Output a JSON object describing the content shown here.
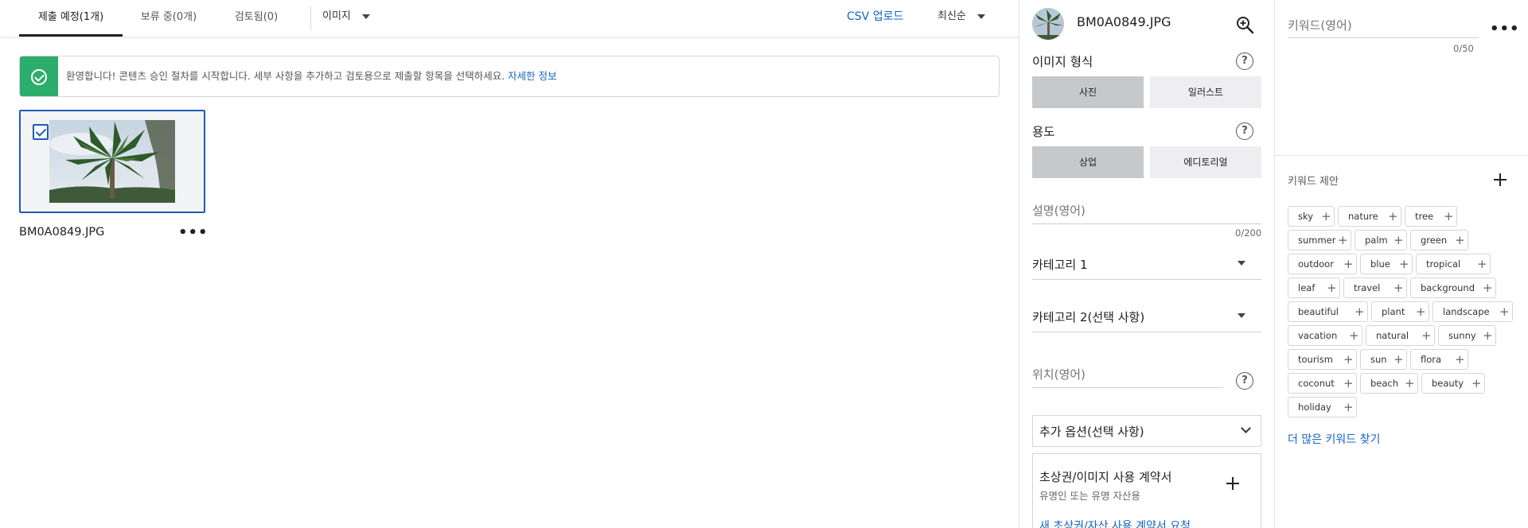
{
  "topbar": {
    "tabs": [
      {
        "label": "제출 예정(1개)",
        "active": true
      },
      {
        "label": "보류 중(0개)",
        "active": false
      },
      {
        "label": "검토됨(0)",
        "active": false
      }
    ],
    "filter_type": "이미지",
    "csv_upload": "CSV 업로드",
    "sort": "최신순"
  },
  "alert": {
    "message": "환영합니다! 콘텐츠 승인 절차를 시작합니다. 세부 사항을 추가하고 검토용으로 제출할 항목을 선택하세요.",
    "link": "자세한 정보",
    "icon": "check-circle-icon",
    "color": "#2bad6b"
  },
  "card": {
    "filename": "BM0A0849.JPG",
    "selected": true
  },
  "details": {
    "filename": "BM0A0849.JPG",
    "image_type_label": "이미지 형식",
    "image_type_options": [
      "사진",
      "일러스트"
    ],
    "usage_label": "용도",
    "usage_options": [
      "상업",
      "에디토리얼"
    ],
    "description_placeholder": "설명(영어)",
    "description_counter": "0/200",
    "category1": "카테고리 1",
    "category2": "카테고리 2(선택 사항)",
    "location_placeholder": "위치(영어)",
    "extra_options": "추가 옵션(선택 사항)",
    "release_title": "초상권/이미지 사용 계약서",
    "release_subtitle": "유명인 또는 유명 자산용",
    "release_link": "새 초상권/자산 사용 계약서 요청"
  },
  "keywords": {
    "placeholder": "키워드(영어)",
    "counter": "0/50",
    "suggest_title": "키워드 제안",
    "suggestions": [
      "sky",
      "nature",
      "tree",
      "summer",
      "palm",
      "green",
      "outdoor",
      "blue",
      "tropical",
      "leaf",
      "travel",
      "background",
      "beautiful",
      "plant",
      "landscape",
      "vacation",
      "natural",
      "sunny",
      "tourism",
      "sun",
      "flora",
      "coconut",
      "beach",
      "beauty",
      "holiday"
    ],
    "find_more": "더 많은 키워드 찾기"
  },
  "colors": {
    "accent_blue": "#1565c0",
    "selected_border": "#1d5bb5",
    "success_green": "#2bad6b"
  }
}
